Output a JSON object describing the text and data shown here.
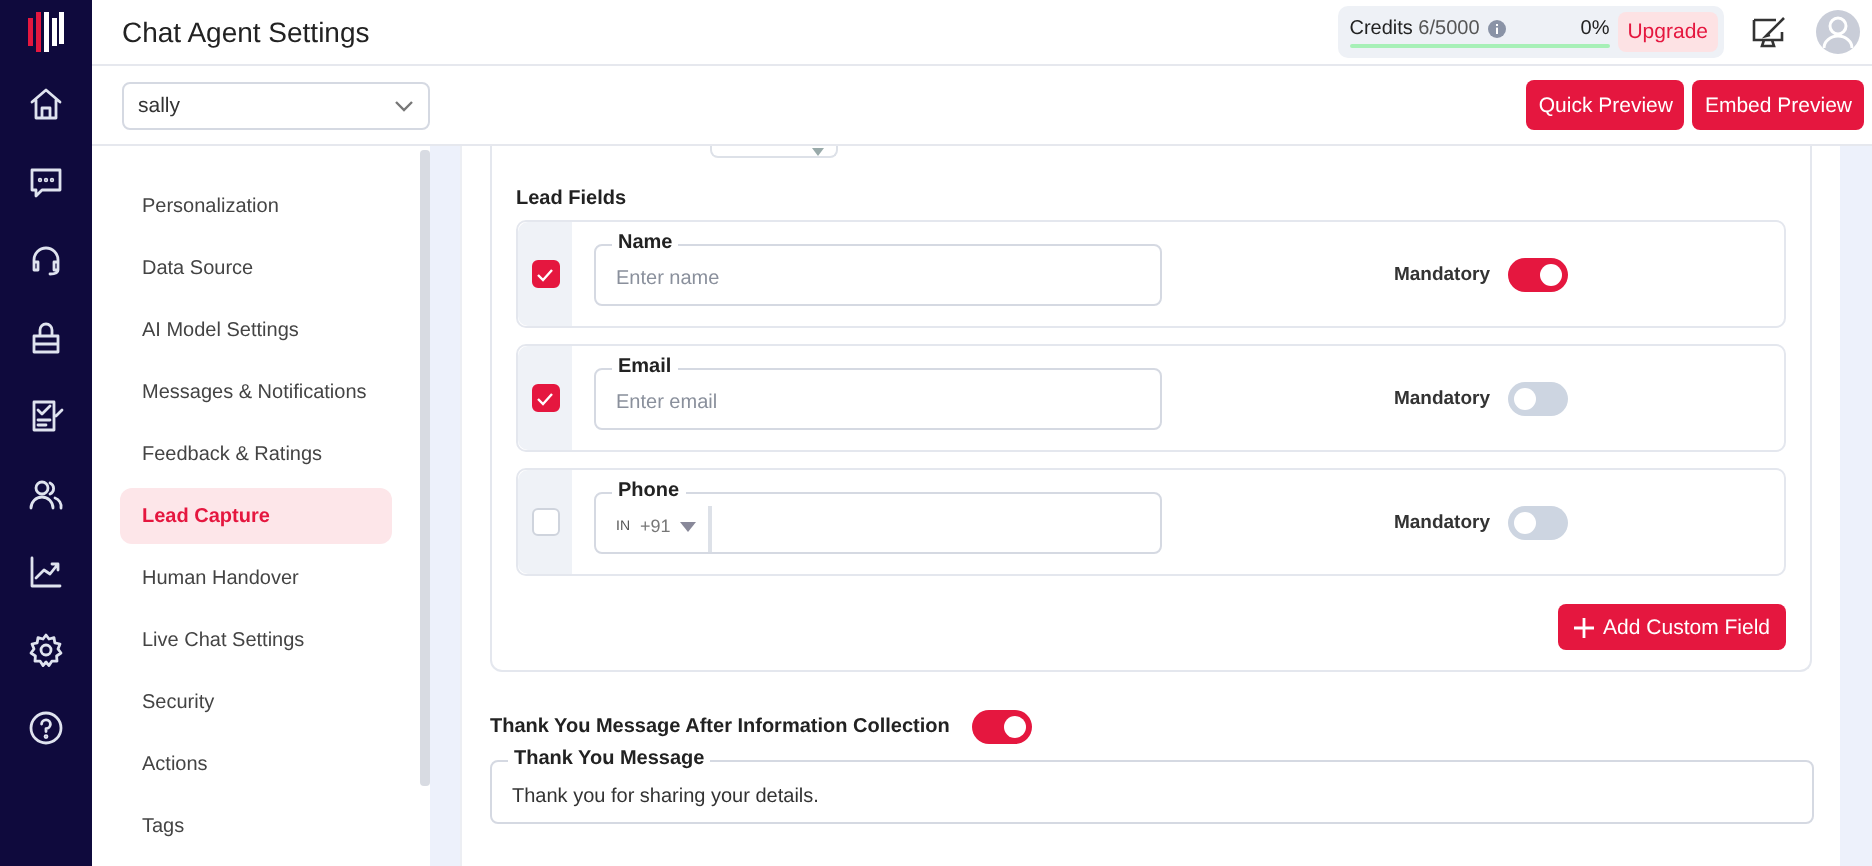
{
  "header": {
    "title": "Chat Agent Settings",
    "credits": {
      "label": "Credits",
      "count": "6/5000",
      "percent": "0%",
      "level": 0
    },
    "upgrade": "Upgrade"
  },
  "agent_select": {
    "value": "sally"
  },
  "actions": [
    "Quick Preview",
    "Embed Preview"
  ],
  "settings_nav": [
    {
      "label": "Personalization",
      "selected": false
    },
    {
      "label": "Data Source",
      "selected": false
    },
    {
      "label": "AI Model Settings",
      "selected": false
    },
    {
      "label": "Messages & Notifications",
      "selected": false
    },
    {
      "label": "Feedback & Ratings",
      "selected": false
    },
    {
      "label": "Lead Capture",
      "selected": true
    },
    {
      "label": "Human Handover",
      "selected": false
    },
    {
      "label": "Live Chat Settings",
      "selected": false
    },
    {
      "label": "Security",
      "selected": false
    },
    {
      "label": "Actions",
      "selected": false
    },
    {
      "label": "Tags",
      "selected": false
    }
  ],
  "lead_fields": {
    "title": "Lead Fields",
    "fields": [
      {
        "kind": "text",
        "label": "Name",
        "placeholder": "Enter name",
        "checked": true,
        "mandatory_label": "Mandatory",
        "mandatory": true
      },
      {
        "kind": "text",
        "label": "Email",
        "placeholder": "Enter email",
        "checked": true,
        "mandatory_label": "Mandatory",
        "mandatory": false
      },
      {
        "kind": "phone",
        "label": "Phone",
        "country": "IN",
        "code": "+91",
        "checked": false,
        "mandatory_label": "Mandatory",
        "mandatory": false
      }
    ],
    "add_button": "Add Custom Field"
  },
  "thank_you": {
    "toggle_label": "Thank You Message After Information Collection",
    "on": true,
    "field_label": "Thank You Message",
    "value": "Thank you for sharing your details."
  }
}
